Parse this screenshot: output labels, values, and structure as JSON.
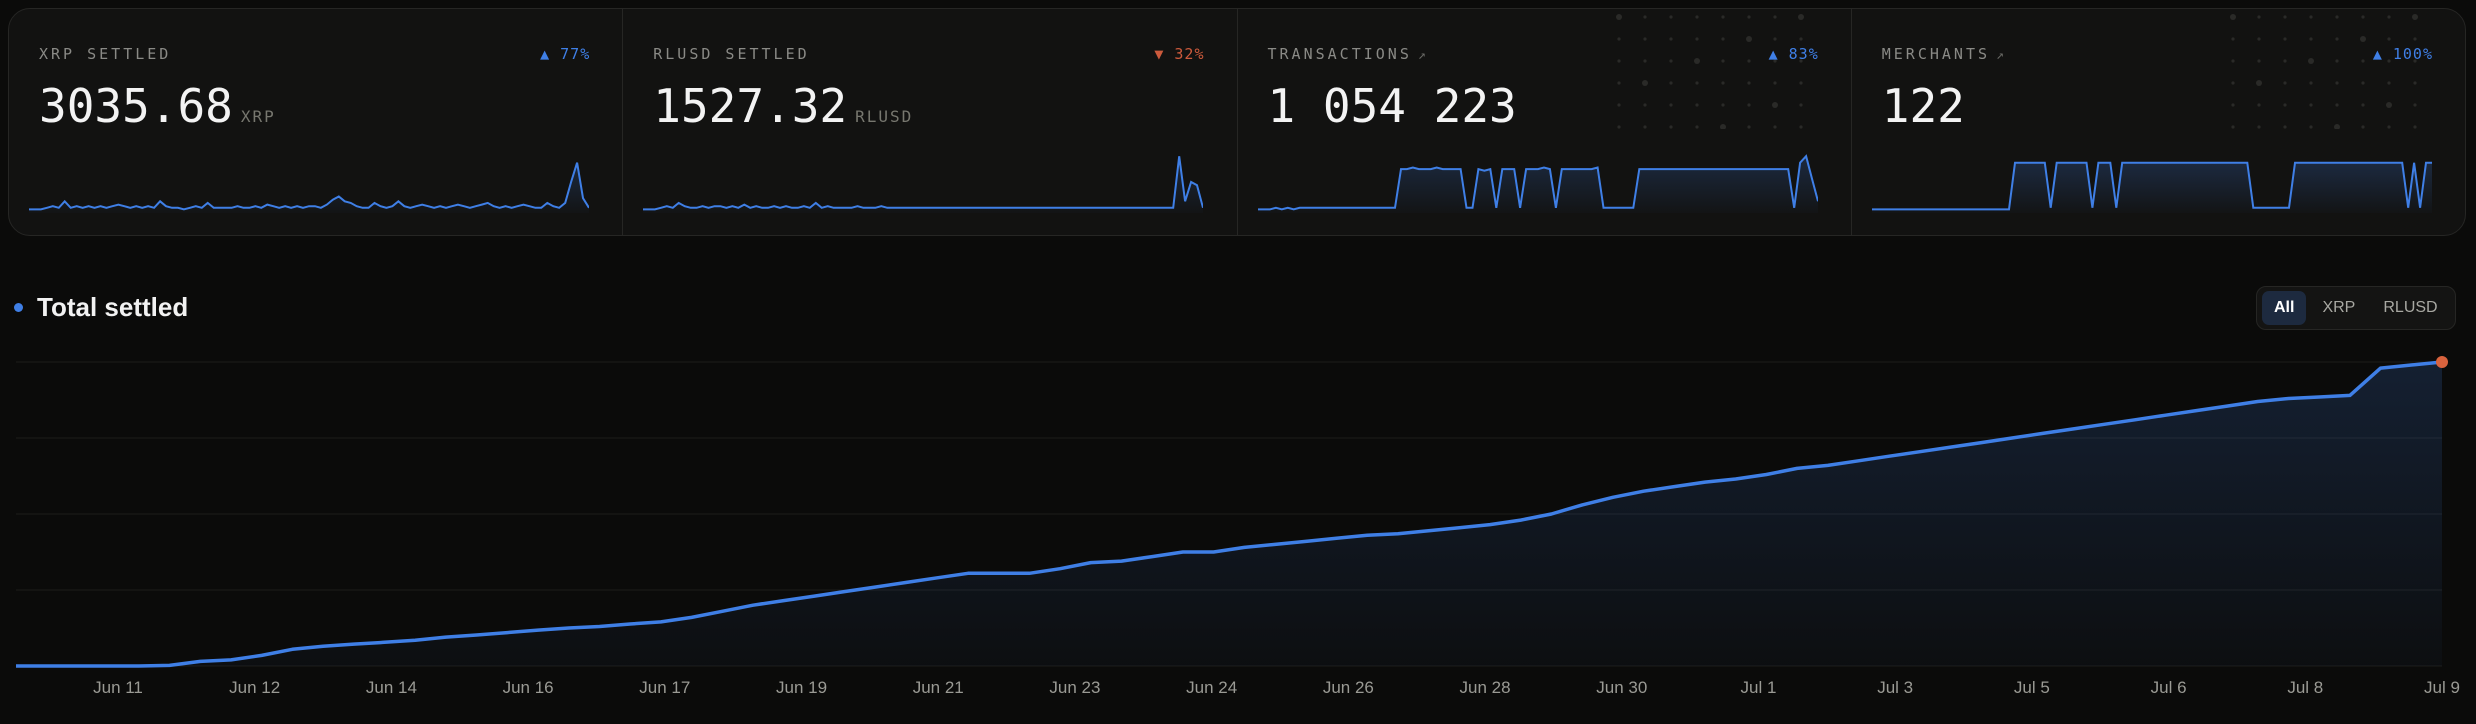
{
  "cards": [
    {
      "label": "XRP SETTLED",
      "link": false,
      "delta": "▲ 77%",
      "delta_dir": "up",
      "value": "3035.68",
      "unit": "XRP",
      "spark": [
        1,
        1,
        1,
        2,
        3,
        2,
        6,
        2,
        3,
        2,
        3,
        2,
        3,
        2,
        3,
        4,
        3,
        2,
        3,
        2,
        3,
        2,
        6,
        3,
        2,
        2,
        1,
        2,
        3,
        2,
        5,
        2,
        2,
        2,
        2,
        3,
        2,
        2,
        3,
        2,
        4,
        3,
        2,
        3,
        2,
        3,
        2,
        3,
        3,
        2,
        4,
        7,
        9,
        6,
        5,
        3,
        2,
        2,
        5,
        3,
        2,
        3,
        6,
        3,
        2,
        3,
        4,
        3,
        2,
        3,
        2,
        3,
        4,
        3,
        2,
        3,
        4,
        5,
        3,
        2,
        3,
        2,
        3,
        4,
        3,
        2,
        2,
        5,
        3,
        2,
        5,
        18,
        30,
        8,
        2
      ]
    },
    {
      "label": "RLUSD SETTLED",
      "link": false,
      "delta": "▼ 32%",
      "delta_dir": "down",
      "value": "1527.32",
      "unit": "RLUSD",
      "spark": [
        1,
        1,
        1,
        2,
        3,
        2,
        5,
        3,
        2,
        2,
        3,
        2,
        3,
        3,
        2,
        3,
        2,
        4,
        2,
        3,
        2,
        2,
        3,
        2,
        3,
        2,
        2,
        3,
        2,
        5,
        2,
        3,
        2,
        2,
        2,
        2,
        3,
        2,
        2,
        2,
        3,
        2,
        2,
        2,
        2,
        2,
        2,
        2,
        2,
        2,
        2,
        2,
        2,
        2,
        2,
        2,
        2,
        2,
        2,
        2,
        2,
        2,
        2,
        2,
        2,
        2,
        2,
        2,
        2,
        2,
        2,
        2,
        2,
        2,
        2,
        2,
        2,
        2,
        2,
        2,
        2,
        2,
        2,
        2,
        2,
        2,
        2,
        2,
        2,
        2,
        34,
        6,
        18,
        16,
        2
      ]
    },
    {
      "label": "TRANSACTIONS",
      "link": true,
      "delta": "▲ 83%",
      "delta_dir": "up",
      "value": "1 054 223",
      "unit": "",
      "spark": [
        1,
        1,
        1,
        2,
        1,
        2,
        1,
        2,
        2,
        2,
        2,
        2,
        2,
        2,
        2,
        2,
        2,
        2,
        2,
        2,
        2,
        2,
        2,
        2,
        26,
        26,
        27,
        26,
        26,
        26,
        27,
        26,
        26,
        26,
        26,
        2,
        2,
        26,
        25,
        26,
        2,
        26,
        26,
        26,
        2,
        26,
        26,
        26,
        27,
        26,
        2,
        26,
        26,
        26,
        26,
        26,
        26,
        27,
        2,
        2,
        2,
        2,
        2,
        2,
        26,
        26,
        26,
        26,
        26,
        26,
        26,
        26,
        26,
        26,
        26,
        26,
        26,
        26,
        26,
        26,
        26,
        26,
        26,
        26,
        26,
        26,
        26,
        26,
        26,
        26,
        2,
        30,
        34,
        20,
        6
      ]
    },
    {
      "label": "MERCHANTS",
      "link": true,
      "delta": "▲ 100%",
      "delta_dir": "up",
      "value": "122",
      "unit": "",
      "spark": [
        1,
        1,
        1,
        1,
        1,
        1,
        1,
        1,
        1,
        1,
        1,
        1,
        1,
        1,
        1,
        1,
        1,
        1,
        1,
        1,
        1,
        1,
        1,
        1,
        30,
        30,
        30,
        30,
        30,
        30,
        2,
        30,
        30,
        30,
        30,
        30,
        30,
        2,
        30,
        30,
        30,
        2,
        30,
        30,
        30,
        30,
        30,
        30,
        30,
        30,
        30,
        30,
        30,
        30,
        30,
        30,
        30,
        30,
        30,
        30,
        30,
        30,
        30,
        30,
        2,
        2,
        2,
        2,
        2,
        2,
        2,
        30,
        30,
        30,
        30,
        30,
        30,
        30,
        30,
        30,
        30,
        30,
        30,
        30,
        30,
        30,
        30,
        30,
        30,
        30,
        2,
        30,
        2,
        30,
        30
      ]
    }
  ],
  "total": {
    "title": "Total settled",
    "filters": [
      "All",
      "XRP",
      "RLUSD"
    ],
    "active_filter": "All"
  },
  "colors": {
    "accent": "#3f7fe6",
    "negative": "#cc5a3c",
    "endpoint": "#d9633e"
  },
  "chart_data": {
    "type": "area",
    "title": "Total settled",
    "x_tick_labels": [
      "Jun 11",
      "Jun 12",
      "Jun 14",
      "Jun 16",
      "Jun 17",
      "Jun 19",
      "Jun 21",
      "Jun 23",
      "Jun 24",
      "Jun 26",
      "Jun 28",
      "Jun 30",
      "Jul 1",
      "Jul 3",
      "Jul 5",
      "Jul 6",
      "Jul 8",
      "Jul 9"
    ],
    "ylim": [
      0,
      100
    ],
    "grid": "horizontal",
    "values": [
      0,
      0,
      0,
      0,
      0,
      0.2,
      1.5,
      2,
      3.5,
      5.5,
      6.5,
      7.2,
      7.8,
      8.5,
      9.5,
      10.2,
      11,
      11.8,
      12.5,
      13,
      13.8,
      14.5,
      16,
      18,
      20,
      21.5,
      23,
      24.5,
      26,
      27.5,
      29,
      30.5,
      30.5,
      30.5,
      32,
      34,
      34.5,
      36,
      37.5,
      37.5,
      39,
      40,
      41,
      42,
      43,
      43.5,
      44.5,
      45.5,
      46.5,
      48,
      50,
      53,
      55.5,
      57.5,
      59,
      60.5,
      61.5,
      63,
      65,
      66,
      67.5,
      69,
      70.5,
      72,
      73.5,
      75,
      76.5,
      78,
      79.5,
      81,
      82.5,
      84,
      85.5,
      87,
      88,
      88.5,
      89,
      98,
      99,
      100
    ]
  }
}
